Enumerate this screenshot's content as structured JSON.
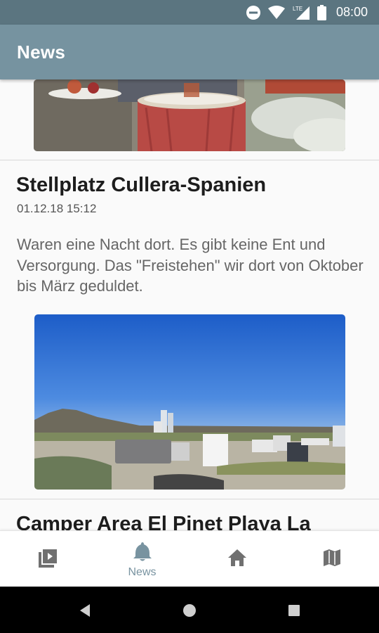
{
  "status_bar": {
    "time": "08:00",
    "network_label": "LTE"
  },
  "app_bar": {
    "title": "News"
  },
  "posts": [
    {
      "title": "Stellplatz Cullera-Spanien",
      "date": "01.12.18 15:12",
      "body": "Waren eine Nacht dort. Es gibt keine Ent und Versorgung. Das \"Freistehen\" wir dort von Oktober bis März geduldet."
    },
    {
      "title": "Camper Area El Pinet Playa La"
    }
  ],
  "bottom_nav": {
    "items": [
      {
        "icon": "video-library-icon",
        "label": ""
      },
      {
        "icon": "bell-icon",
        "label": "News",
        "active": true
      },
      {
        "icon": "home-icon",
        "label": ""
      },
      {
        "icon": "map-icon",
        "label": ""
      }
    ]
  },
  "colors": {
    "status_bar": "#5b7580",
    "app_bar": "#7693a0",
    "accent": "#7893a0"
  }
}
